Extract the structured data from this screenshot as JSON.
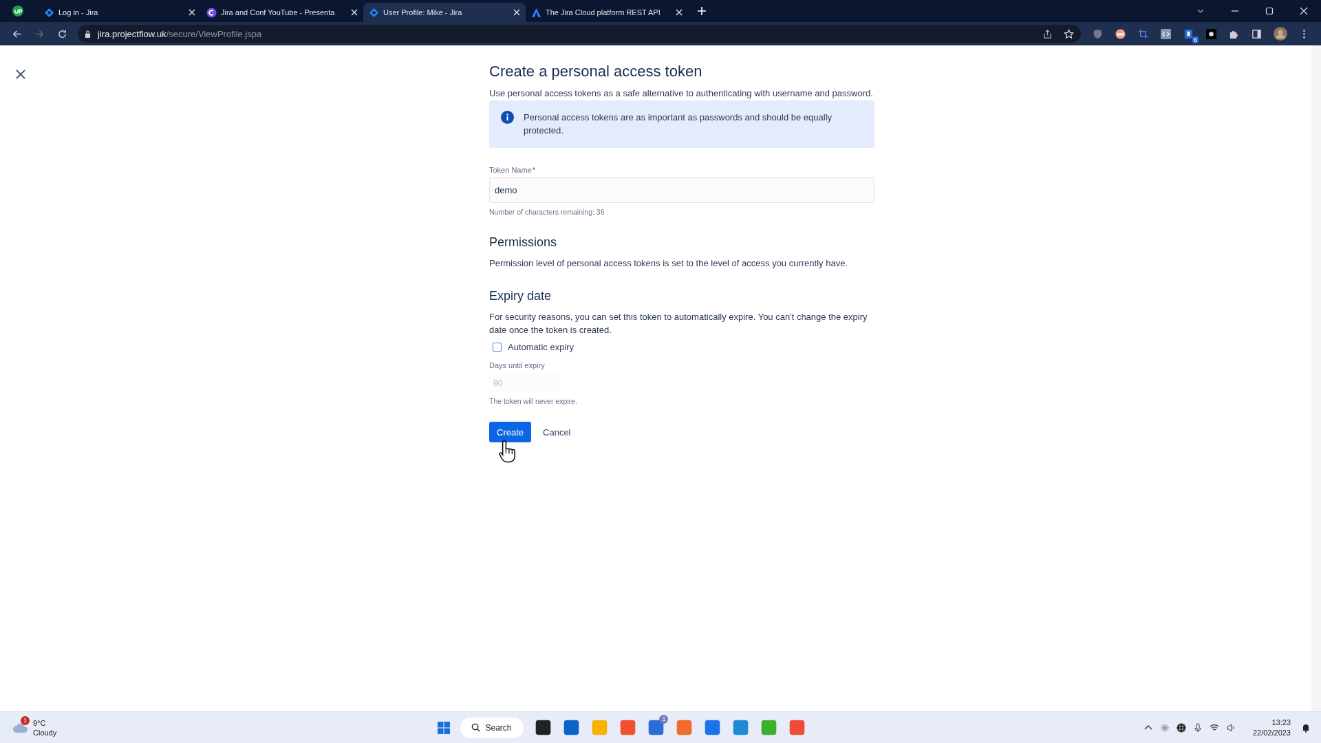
{
  "browser": {
    "tabs": [
      {
        "title": "Log in - Jira",
        "selected": false
      },
      {
        "title": "Jira and Conf YouTube - Presenta",
        "selected": false
      },
      {
        "title": "User Profile: Mike - Jira",
        "selected": true
      },
      {
        "title": "The Jira Cloud platform REST API",
        "selected": false
      }
    ],
    "url": {
      "host": "jira.projectflow.uk",
      "path": "/secure/ViewProfile.jspa"
    },
    "extension_badge": "6"
  },
  "page": {
    "title": "Create a personal access token",
    "intro": "Use personal access tokens as a safe alternative to authenticating with username and password.",
    "info_message": "Personal access tokens are as important as passwords and should be equally protected.",
    "token_field": {
      "label": "Token Name",
      "required_mark": "*",
      "value": "demo",
      "hint": "Number of characters remaining: 36"
    },
    "permissions": {
      "heading": "Permissions",
      "text": "Permission level of personal access tokens is set to the level of access you currently have."
    },
    "expiry": {
      "heading": "Expiry date",
      "text": "For security reasons, you can set this token to automatically expire. You can't change the expiry date once the token is created.",
      "checkbox": {
        "label": "Automatic expiry",
        "checked": false
      },
      "days_field": {
        "label": "Days until expiry",
        "value": "90",
        "disabled": true
      },
      "hint": "The token will never expire."
    },
    "buttons": [
      {
        "label": "Create",
        "kind": "primary"
      },
      {
        "label": "Cancel",
        "kind": "subtle"
      }
    ]
  },
  "taskbar": {
    "weather": {
      "badge": "1",
      "temperature": "9°C",
      "condition": "Cloudy"
    },
    "search": "Search",
    "apps": [
      {
        "kind": "explorer-dark"
      },
      {
        "kind": "outlook"
      },
      {
        "kind": "folder"
      },
      {
        "kind": "brave"
      },
      {
        "kind": "check",
        "badge": "1"
      },
      {
        "kind": "compass"
      },
      {
        "kind": "chrome"
      },
      {
        "kind": "vscode"
      },
      {
        "kind": "green-c"
      },
      {
        "kind": "red-c"
      }
    ],
    "time": "13:23",
    "date": "22/02/2023"
  }
}
